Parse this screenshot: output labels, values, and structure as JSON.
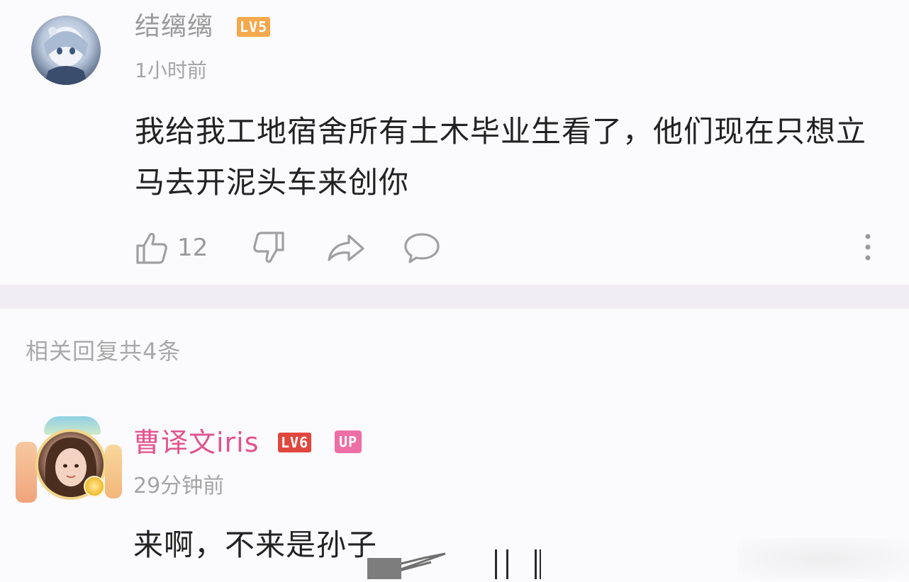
{
  "main_comment": {
    "username": "结缡缡",
    "level_badge": "LV5",
    "time": "1小时前",
    "text": "我给我工地宿舍所有土木毕业生看了，他们现在只想立马去开泥头车来创你",
    "like_count": "12"
  },
  "replies": {
    "header": "相关回复共4条",
    "items": [
      {
        "username": "曹译文iris",
        "level_badge": "LV6",
        "up_badge": "UP",
        "time": "29分钟前",
        "text": "来啊，不来是孙子"
      }
    ]
  },
  "colors": {
    "username_main": "#9b9b9b",
    "username_up": "#e3528f",
    "lv5": "#f3a94c",
    "lv6": "#e0473f",
    "up": "#ee6fa5",
    "muted": "#a5a5a5"
  },
  "icons": {
    "like": "thumbs-up-icon",
    "dislike": "thumbs-down-icon",
    "share": "share-arrow-icon",
    "reply": "speech-bubble-icon",
    "more": "vertical-dots-icon"
  }
}
